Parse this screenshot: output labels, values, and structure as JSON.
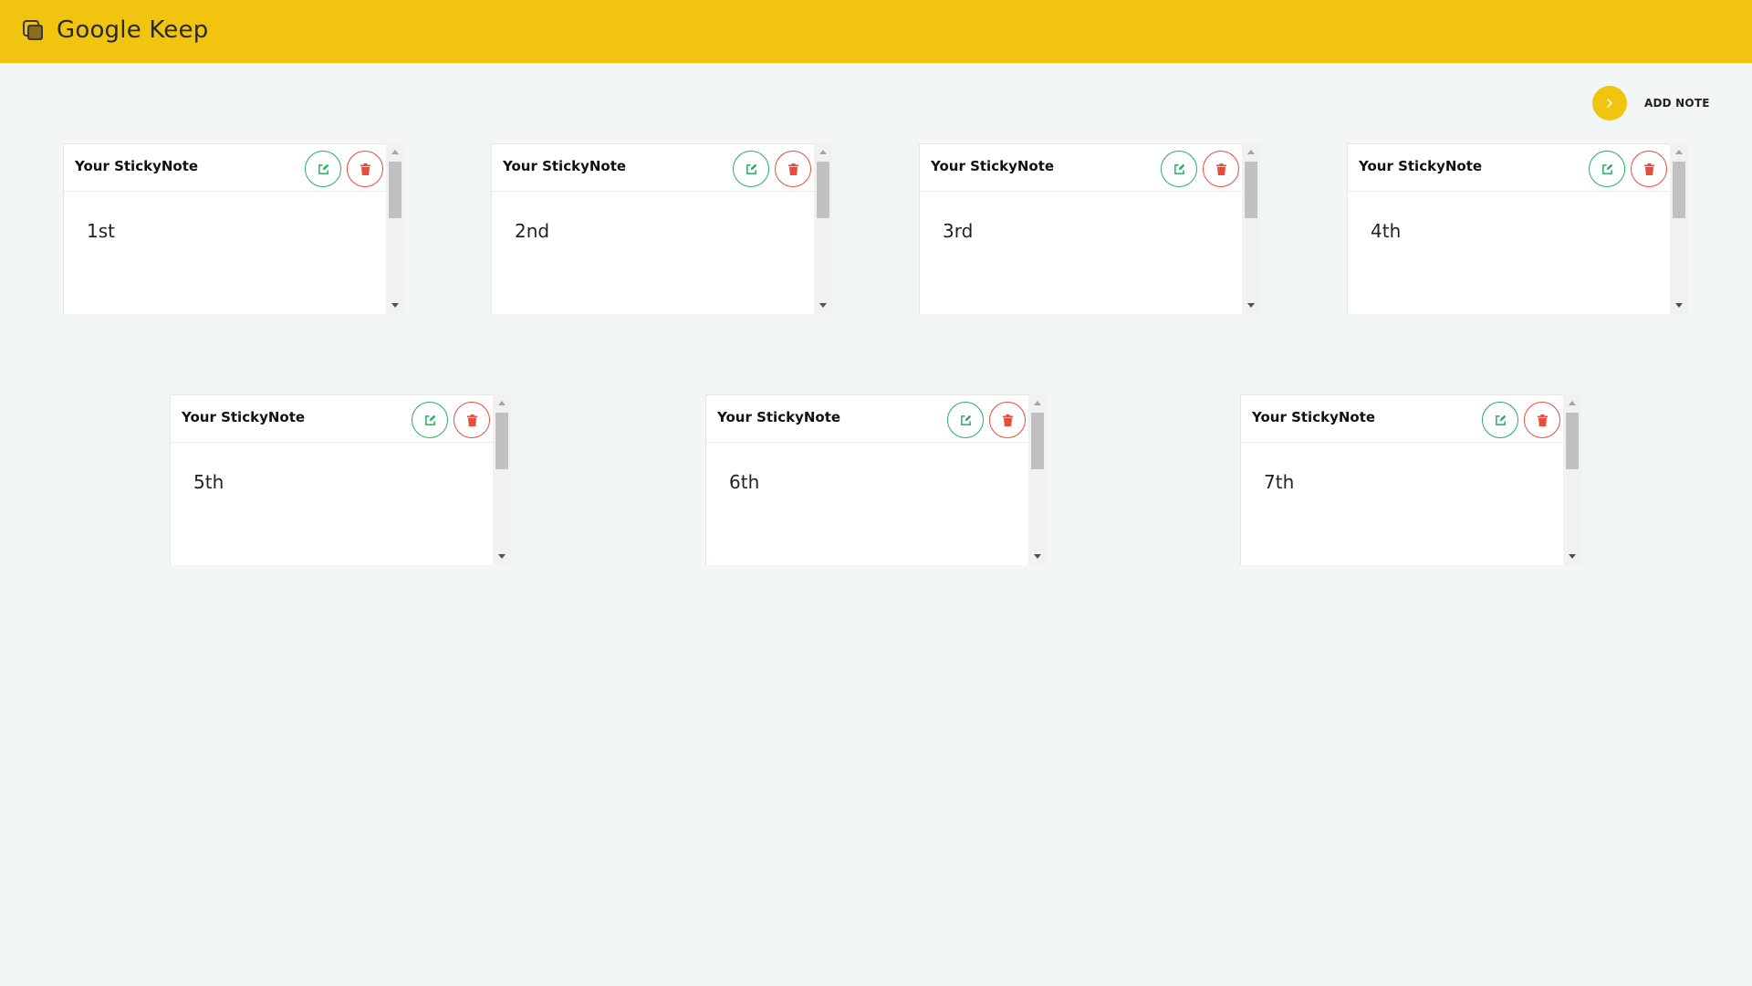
{
  "header": {
    "title": "Google Keep",
    "logo_icon": "stacked-notes-icon",
    "background": "#f1c40f"
  },
  "add_note": {
    "label": "ADD NOTE",
    "icon": "chevron-right-icon"
  },
  "notes": [
    {
      "title": "Your StickyNote",
      "text": "1st"
    },
    {
      "title": "Your StickyNote",
      "text": "2nd"
    },
    {
      "title": "Your StickyNote",
      "text": "3rd"
    },
    {
      "title": "Your StickyNote",
      "text": "4th"
    },
    {
      "title": "Your StickyNote",
      "text": "5th"
    },
    {
      "title": "Your StickyNote",
      "text": "6th"
    },
    {
      "title": "Your StickyNote",
      "text": "7th"
    }
  ],
  "colors": {
    "edit": "#27ae60",
    "delete": "#e74c3c",
    "page_bg": "#f3f6f6"
  }
}
